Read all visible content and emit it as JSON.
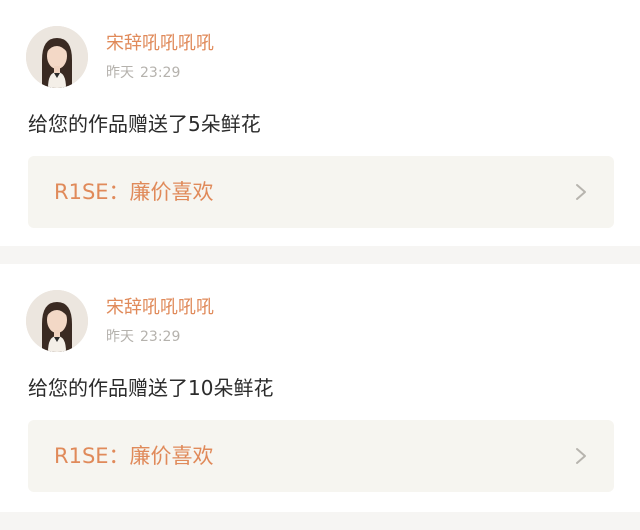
{
  "colors": {
    "accent": "#e08a5a",
    "text": "#2b2b2b",
    "muted": "#b5b2ad",
    "background": "#f6f5f3",
    "card": "#ffffff",
    "link_box": "#f6f5f0"
  },
  "icons": {
    "avatar": "avatar-portrait",
    "chevron": "chevron-right-icon"
  },
  "posts": [
    {
      "username": "宋辞吼吼吼吼",
      "date": "昨天",
      "time": "23:29",
      "message": "给您的作品赠送了5朵鲜花",
      "link": "R1SE：廉价喜欢"
    },
    {
      "username": "宋辞吼吼吼吼",
      "date": "昨天",
      "time": "23:29",
      "message": "给您的作品赠送了10朵鲜花",
      "link": "R1SE：廉价喜欢"
    }
  ]
}
